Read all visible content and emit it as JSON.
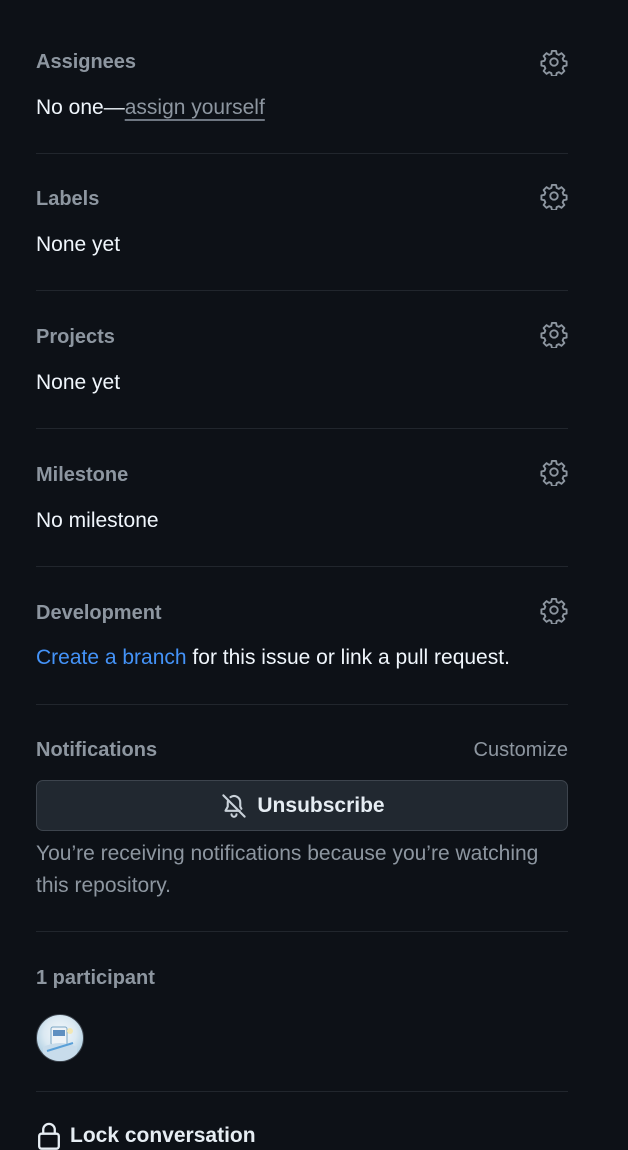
{
  "assignees": {
    "heading": "Assignees",
    "value_prefix": "No one—",
    "assign_link": "assign yourself",
    "gear_icon": "gear-icon"
  },
  "labels": {
    "heading": "Labels",
    "value": "None yet",
    "gear_icon": "gear-icon"
  },
  "projects": {
    "heading": "Projects",
    "value": "None yet",
    "gear_icon": "gear-icon"
  },
  "milestone": {
    "heading": "Milestone",
    "value": "No milestone",
    "gear_icon": "gear-icon"
  },
  "development": {
    "heading": "Development",
    "create_branch_link": "Create a branch",
    "value_suffix": " for this issue or link a pull request.",
    "gear_icon": "gear-icon"
  },
  "notifications": {
    "heading": "Notifications",
    "customize": "Customize",
    "unsubscribe_label": "Unsubscribe",
    "unsubscribe_icon": "bell-slash-icon",
    "note": "You’re receiving notifications because you’re watching this repository."
  },
  "participants": {
    "heading": "1 participant",
    "count": 1
  },
  "lock": {
    "label": "Lock conversation",
    "icon": "lock-icon"
  },
  "colors": {
    "background": "#0d1117",
    "heading": "#8d96a0",
    "text": "#f0f6fc",
    "accent": "#4493f8",
    "border": "#21262d"
  }
}
